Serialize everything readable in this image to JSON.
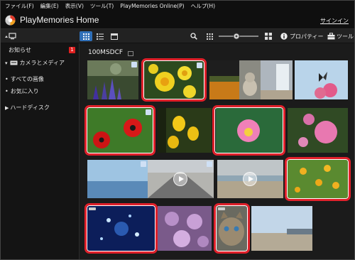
{
  "menubar": {
    "items": [
      {
        "label": "ファイル(F)"
      },
      {
        "label": "編集(E)"
      },
      {
        "label": "表示(V)"
      },
      {
        "label": "ツール(T)"
      },
      {
        "label": "PlayMemories Online(P)"
      },
      {
        "label": "ヘルプ(H)"
      }
    ]
  },
  "titlebar": {
    "app_title": "PlayMemories Home",
    "signin_label": "サインイン"
  },
  "toolbar": {
    "properties_label": "プロパティー",
    "tools_label": "ツール"
  },
  "sidebar": {
    "notice_label": "お知らせ",
    "notice_count": "1",
    "camera_media_label": "カメラとメディア",
    "all_images_label": "すべての画像",
    "favorites_label": "お気に入り",
    "hard_disk_label": "ハードディスク"
  },
  "content": {
    "folder_name": "100MSDCF"
  },
  "colors": {
    "accent_blue": "#2f6fb8",
    "selection_red": "#e0202a",
    "badge_red": "#e02020"
  }
}
